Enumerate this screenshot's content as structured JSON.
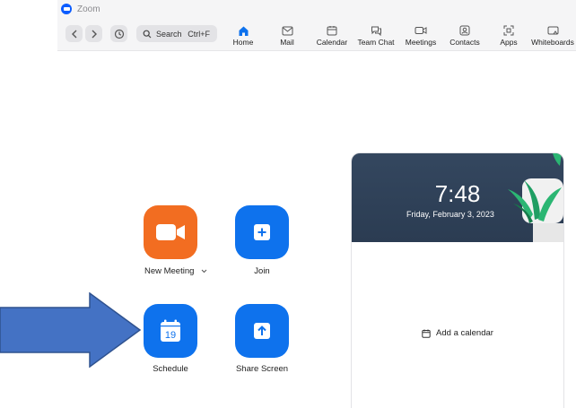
{
  "window": {
    "title": "Zoom"
  },
  "toolbar": {
    "search_label": "Search",
    "search_shortcut": "Ctrl+F",
    "tabs": [
      {
        "label": "Home",
        "icon": "home-icon",
        "active": true
      },
      {
        "label": "Mail",
        "icon": "mail-icon"
      },
      {
        "label": "Calendar",
        "icon": "calendar-icon"
      },
      {
        "label": "Team Chat",
        "icon": "chat-icon"
      },
      {
        "label": "Meetings",
        "icon": "video-icon"
      },
      {
        "label": "Contacts",
        "icon": "contacts-icon"
      },
      {
        "label": "Apps",
        "icon": "apps-icon"
      },
      {
        "label": "Whiteboards",
        "icon": "whiteboard-icon"
      }
    ]
  },
  "actions": {
    "new_meeting": "New Meeting",
    "join": "Join",
    "schedule": "Schedule",
    "schedule_icon_day": "19",
    "share_screen": "Share Screen"
  },
  "calendar_card": {
    "time": "7:48",
    "date": "Friday, February 3, 2023",
    "add_calendar": "Add a calendar"
  },
  "colors": {
    "accent_blue": "#0e72ed",
    "new_meeting_orange": "#f26d21",
    "arrow_fill": "#4472c4",
    "arrow_stroke": "#2f528f",
    "hero_bg": "#2f425a"
  }
}
